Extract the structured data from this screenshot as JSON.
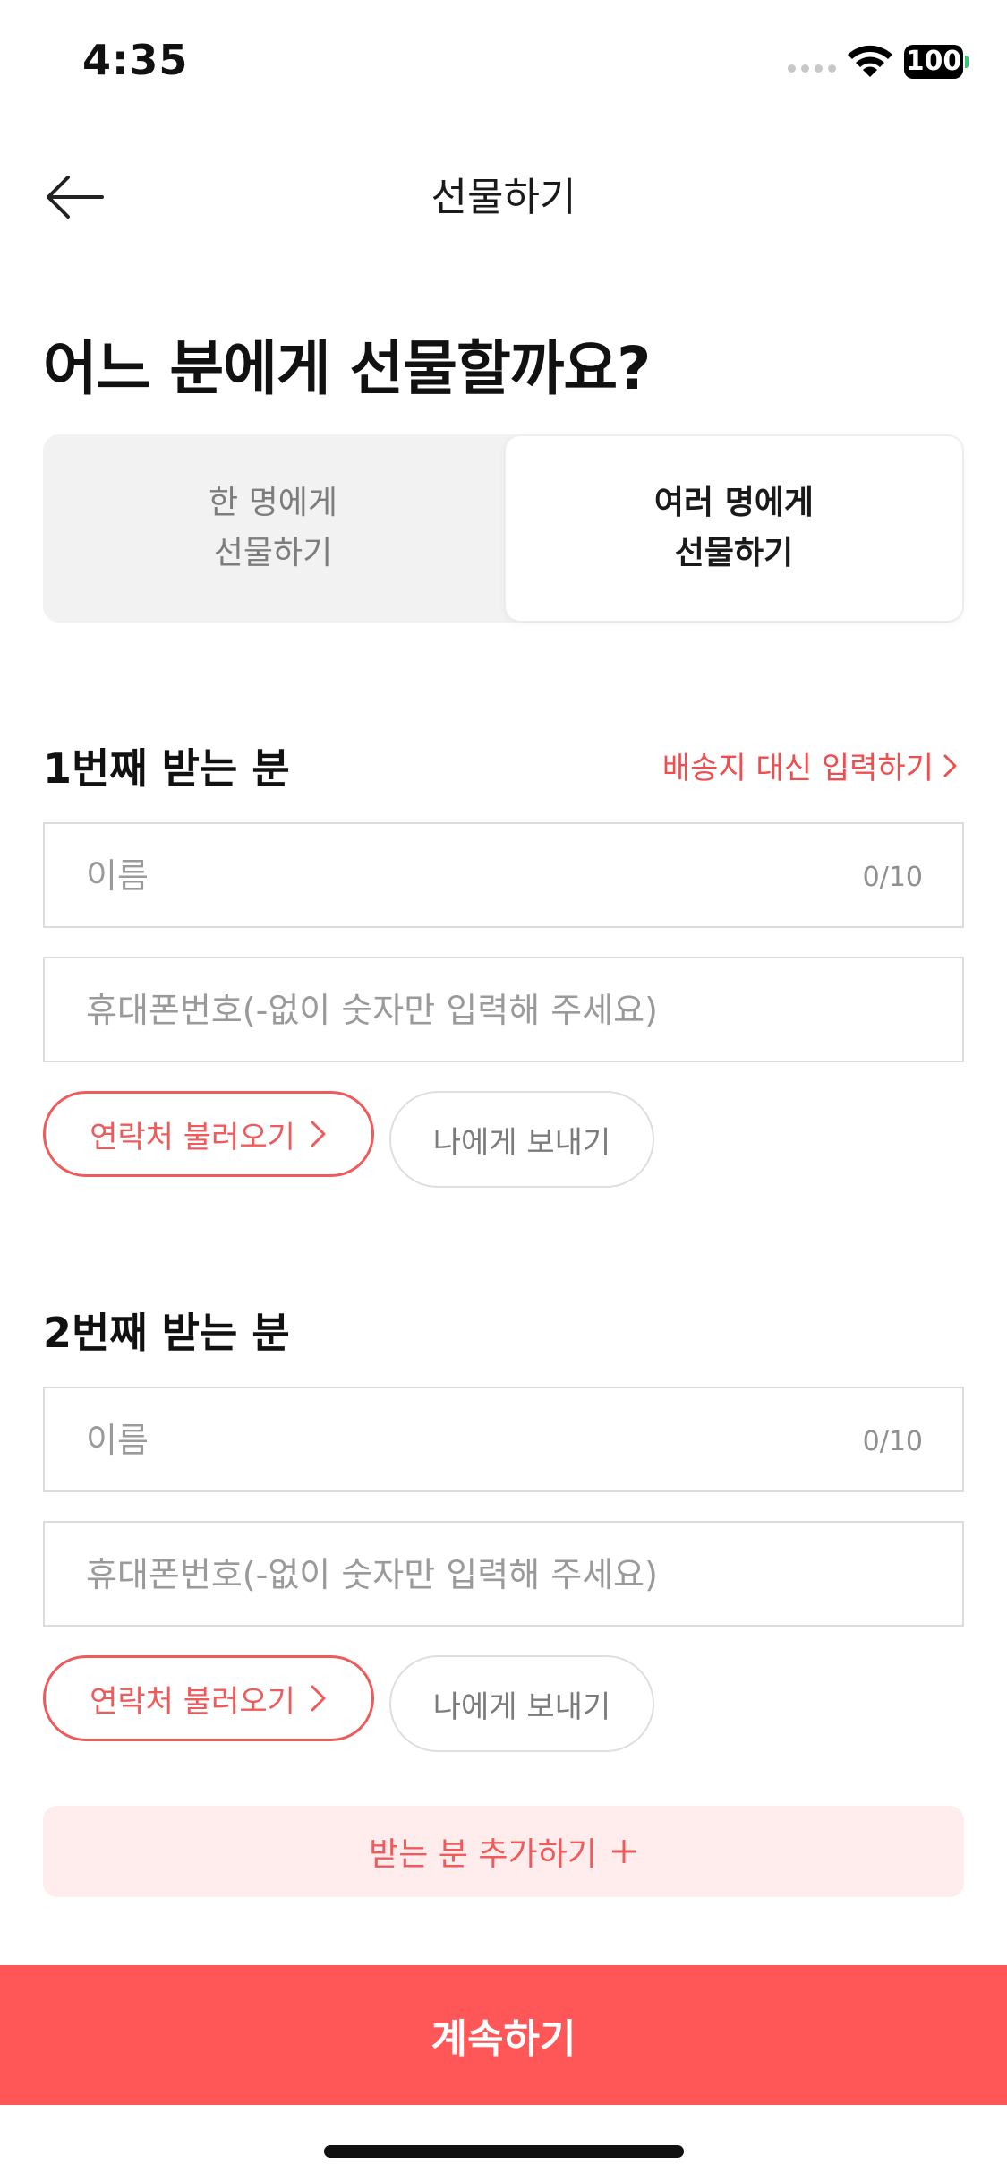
{
  "status_bar": {
    "time": "4:35",
    "battery": "100"
  },
  "nav": {
    "title": "선물하기",
    "back_icon": "arrow-left-icon"
  },
  "headline": "어느 분에게 선물할까요?",
  "segment": {
    "options": [
      "한 명에게\n선물하기",
      "여러 명에게\n선물하기"
    ],
    "selected": "여러 명에게\n선물하기"
  },
  "recipients": [
    {
      "title": "1번째 받는 분",
      "alt_link": "배송지 대신 입력하기",
      "name_placeholder": "이름",
      "name_counter": "0/10",
      "phone_placeholder": "휴대폰번호(-없이 숫자만 입력해 주세요)",
      "contacts_button": "연락처 불러오기",
      "self_button": "나에게 보내기"
    },
    {
      "title": "2번째 받는 분",
      "name_placeholder": "이름",
      "name_counter": "0/10",
      "phone_placeholder": "휴대폰번호(-없이 숫자만 입력해 주세요)",
      "contacts_button": "연락처 불러오기",
      "self_button": "나에게 보내기"
    }
  ],
  "add_recipient": "받는 분 추가하기",
  "continue_button": "계속하기",
  "colors": {
    "accent": "#ff5757",
    "accent_text": "#f05a5a",
    "add_bg": "#ffecec"
  }
}
